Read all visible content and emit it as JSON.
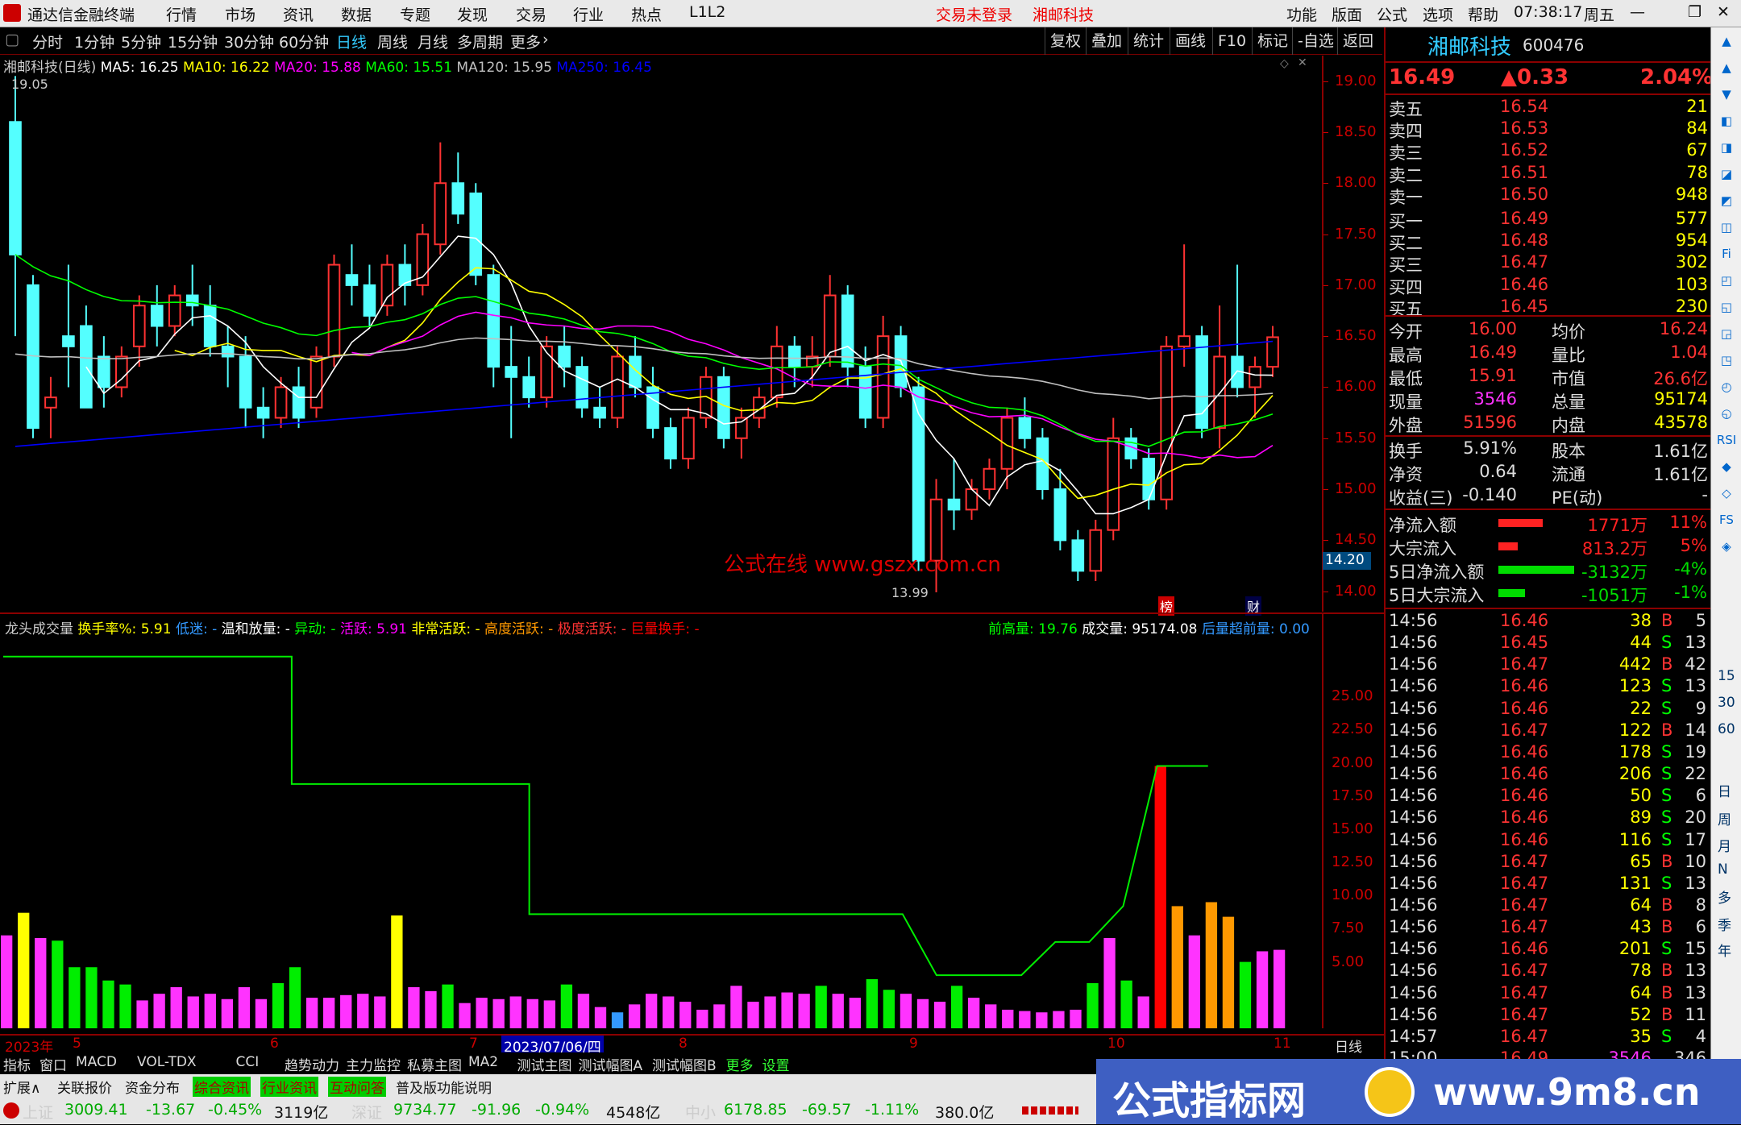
{
  "app": {
    "title": "通达信金融终端",
    "menu": [
      "行情",
      "市场",
      "资讯",
      "数据",
      "专题",
      "发现",
      "交易",
      "行业",
      "热点",
      "L1L2"
    ],
    "login_status": "交易未登录",
    "stock_link": "湘邮科技",
    "right_menu": [
      "功能",
      "版面",
      "公式",
      "选项",
      "帮助"
    ],
    "time": "07:38:17",
    "weekday": "周五"
  },
  "timeframes": [
    "分时",
    "1分钟",
    "5分钟",
    "15分钟",
    "30分钟",
    "60分钟",
    "日线",
    "周线",
    "月线",
    "多周期",
    "更多"
  ],
  "active_timeframe": "日线",
  "toolbar_right": [
    "复权",
    "叠加",
    "统计",
    "画线",
    "F10",
    "标记",
    "-自选",
    "返回"
  ],
  "main_chart": {
    "name": "湘邮科技(日线)",
    "ma": [
      {
        "label": "MA5",
        "value": "16.25",
        "color": "#ffffff"
      },
      {
        "label": "MA10",
        "value": "16.22",
        "color": "#ffff00"
      },
      {
        "label": "MA20",
        "value": "15.88",
        "color": "#ff00ff"
      },
      {
        "label": "MA60",
        "value": "15.51",
        "color": "#00ff00"
      },
      {
        "label": "MA120",
        "value": "15.95",
        "color": "#c0c0c0"
      },
      {
        "label": "MA250",
        "value": "16.45",
        "color": "#0000ff"
      }
    ],
    "high_mark": "19.05",
    "low_mark": "13.99",
    "price_ticks": [
      "19.00",
      "18.50",
      "18.00",
      "17.50",
      "17.00",
      "16.50",
      "16.00",
      "15.50",
      "15.00",
      "14.50",
      "14.00"
    ],
    "current_price_tag": "14.20",
    "watermark": "公式在线  www.gszx.com.cn",
    "event_markers": [
      "榜",
      "财"
    ]
  },
  "sub_chart": {
    "name": "龙头成交量",
    "items": [
      {
        "label": "换手率%:",
        "value": "5.91",
        "color": "#ffff00"
      },
      {
        "label": "低迷:",
        "value": "-",
        "color": "#3399ff"
      },
      {
        "label": "温和放量:",
        "value": "-",
        "color": "#ffffff"
      },
      {
        "label": "异动:",
        "value": "-",
        "color": "#00ff00"
      },
      {
        "label": "活跃:",
        "value": "5.91",
        "color": "#ff00ff"
      },
      {
        "label": "非常活跃:",
        "value": "-",
        "color": "#ffff00"
      },
      {
        "label": "高度活跃:",
        "value": "-",
        "color": "#ff9900"
      },
      {
        "label": "极度活跃:",
        "value": "-",
        "color": "#ff3333"
      },
      {
        "label": "巨量换手:",
        "value": "-",
        "color": "#ff0000"
      }
    ],
    "right_items": [
      {
        "label": "前高量:",
        "value": "19.76",
        "color": "#00ff00"
      },
      {
        "label": "成交量:",
        "value": "95174.08",
        "color": "#ffffff"
      },
      {
        "label": "后量超前量:",
        "value": "0.00",
        "color": "#3399ff"
      }
    ],
    "ticks": [
      "25.00",
      "22.50",
      "20.00",
      "17.50",
      "15.00",
      "12.50",
      "10.00",
      "7.50",
      "5.00"
    ]
  },
  "date_axis": {
    "labels": [
      "2023年",
      "5",
      "6",
      "7",
      "8",
      "9",
      "10",
      "11"
    ],
    "cursor_date": "2023/07/06/四",
    "period": "日线"
  },
  "quote": {
    "name": "湘邮科技",
    "code": "600476",
    "price": "16.49",
    "change": "▲0.33",
    "pct": "2.04%",
    "asks": [
      [
        "卖五",
        "16.54",
        "21"
      ],
      [
        "卖四",
        "16.53",
        "84"
      ],
      [
        "卖三",
        "16.52",
        "67"
      ],
      [
        "卖二",
        "16.51",
        "78"
      ],
      [
        "卖一",
        "16.50",
        "948"
      ]
    ],
    "bids": [
      [
        "买一",
        "16.49",
        "577"
      ],
      [
        "买二",
        "16.48",
        "954"
      ],
      [
        "买三",
        "16.47",
        "302"
      ],
      [
        "买四",
        "16.46",
        "103"
      ],
      [
        "买五",
        "16.45",
        "230"
      ]
    ],
    "stats": [
      [
        "今开",
        "16.00",
        "均价",
        "16.24"
      ],
      [
        "最高",
        "16.49",
        "量比",
        "1.04"
      ],
      [
        "最低",
        "15.91",
        "市值",
        "26.6亿"
      ],
      [
        "现量",
        "3546",
        "总量",
        "95174"
      ],
      [
        "外盘",
        "51596",
        "内盘",
        "43578"
      ]
    ],
    "stats2": [
      [
        "换手",
        "5.91%",
        "股本",
        "1.61亿"
      ],
      [
        "净资",
        "0.64",
        "流通",
        "1.61亿"
      ],
      [
        "收益(三)",
        "-0.140",
        "PE(动)",
        "-"
      ]
    ],
    "flows": [
      {
        "label": "净流入额",
        "value": "1771万",
        "pct": "11%",
        "bar": 0.5,
        "color": "#ff2222"
      },
      {
        "label": "大宗流入",
        "value": "813.2万",
        "pct": "5%",
        "bar": 0.22,
        "color": "#ff2222"
      },
      {
        "label": "5日净流入额",
        "value": "-3132万",
        "pct": "-4%",
        "bar": 0.85,
        "color": "#00dd00"
      },
      {
        "label": "5日大宗流入",
        "value": "-1051万",
        "pct": "-1%",
        "bar": 0.3,
        "color": "#00dd00"
      }
    ],
    "ticks": [
      [
        "14:56",
        "16.46",
        "38",
        "B",
        "5"
      ],
      [
        "14:56",
        "16.45",
        "44",
        "S",
        "13"
      ],
      [
        "14:56",
        "16.47",
        "442",
        "B",
        "42"
      ],
      [
        "14:56",
        "16.46",
        "123",
        "S",
        "13"
      ],
      [
        "14:56",
        "16.46",
        "22",
        "S",
        "9"
      ],
      [
        "14:56",
        "16.47",
        "122",
        "B",
        "14"
      ],
      [
        "14:56",
        "16.46",
        "178",
        "S",
        "19"
      ],
      [
        "14:56",
        "16.46",
        "206",
        "S",
        "22"
      ],
      [
        "14:56",
        "16.46",
        "50",
        "S",
        "6"
      ],
      [
        "14:56",
        "16.46",
        "89",
        "S",
        "20"
      ],
      [
        "14:56",
        "16.46",
        "116",
        "S",
        "17"
      ],
      [
        "14:56",
        "16.47",
        "65",
        "B",
        "10"
      ],
      [
        "14:56",
        "16.47",
        "131",
        "S",
        "13"
      ],
      [
        "14:56",
        "16.47",
        "64",
        "B",
        "8"
      ],
      [
        "14:56",
        "16.47",
        "43",
        "B",
        "6"
      ],
      [
        "14:56",
        "16.46",
        "201",
        "S",
        "15"
      ],
      [
        "14:56",
        "16.47",
        "78",
        "B",
        "13"
      ],
      [
        "14:56",
        "16.47",
        "64",
        "B",
        "13"
      ],
      [
        "14:56",
        "16.47",
        "52",
        "B",
        "11"
      ],
      [
        "14:57",
        "16.47",
        "35",
        "S",
        "4"
      ],
      [
        "15:00",
        "16.49",
        "3546",
        "",
        "346"
      ]
    ]
  },
  "side_labels": [
    "日",
    "周",
    "月",
    "N",
    "多",
    "季",
    "年",
    "15",
    "30",
    "60"
  ],
  "bottom_tabs": [
    "指标",
    "窗口",
    "MACD",
    "VOL-TDX",
    "CCI",
    "趋势动力",
    "主力监控",
    "私募主图",
    "MA2",
    "测试主图",
    "测试幅图A",
    "测试幅图B",
    "更多",
    "设置"
  ],
  "bottom_tabs2": [
    "扩展∧",
    "关联报价",
    "资金分布",
    "综合资讯",
    "行业资讯",
    "互动问答",
    "普及版功能说明"
  ],
  "status": {
    "sh_label": "上证",
    "sh": "3009.41",
    "sh_chg": "-13.67",
    "sh_pct": "-0.45%",
    "sh_amt": "3119亿",
    "sz_label": "深证",
    "sz": "9734.77",
    "sz_chg": "-91.96",
    "sz_pct": "-0.94%",
    "sz_amt": "4548亿",
    "zx_label": "中小",
    "zx": "6178.85",
    "zx_chg": "-69.57",
    "zx_pct": "-1.11%",
    "zx_amt": "380.0亿"
  },
  "banner": {
    "text": "公式指标网",
    "url": "www.9m8.cn"
  },
  "candles": [
    [
      18.6,
      19.05,
      16.5,
      17.3
    ],
    [
      17.0,
      17.1,
      15.5,
      15.6
    ],
    [
      15.8,
      16.1,
      15.5,
      15.9
    ],
    [
      16.5,
      17.2,
      16.0,
      16.4
    ],
    [
      16.6,
      16.8,
      15.8,
      15.8
    ],
    [
      16.3,
      16.5,
      15.8,
      16.0
    ],
    [
      16.0,
      16.4,
      15.9,
      16.3
    ],
    [
      16.4,
      16.9,
      16.2,
      16.8
    ],
    [
      16.8,
      17.0,
      16.4,
      16.6
    ],
    [
      16.6,
      17.0,
      16.5,
      16.9
    ],
    [
      16.9,
      17.2,
      16.6,
      16.8
    ],
    [
      16.8,
      17.0,
      16.3,
      16.4
    ],
    [
      16.4,
      16.6,
      16.0,
      16.3
    ],
    [
      16.3,
      16.5,
      15.6,
      15.8
    ],
    [
      15.8,
      16.0,
      15.5,
      15.7
    ],
    [
      15.7,
      16.1,
      15.6,
      16.0
    ],
    [
      16.0,
      16.2,
      15.6,
      15.7
    ],
    [
      15.8,
      16.4,
      15.7,
      16.3
    ],
    [
      16.3,
      17.3,
      16.2,
      17.2
    ],
    [
      17.1,
      17.4,
      16.8,
      17.0
    ],
    [
      17.0,
      17.2,
      16.6,
      16.7
    ],
    [
      16.8,
      17.3,
      16.7,
      17.2
    ],
    [
      17.2,
      17.4,
      16.8,
      17.0
    ],
    [
      17.0,
      17.6,
      16.9,
      17.5
    ],
    [
      17.4,
      18.4,
      17.3,
      18.0
    ],
    [
      18.0,
      18.3,
      17.6,
      17.7
    ],
    [
      17.9,
      18.0,
      17.0,
      17.1
    ],
    [
      17.1,
      17.2,
      16.0,
      16.2
    ],
    [
      16.2,
      16.6,
      15.5,
      16.1
    ],
    [
      16.1,
      16.3,
      15.8,
      15.9
    ],
    [
      15.9,
      16.5,
      15.8,
      16.4
    ],
    [
      16.4,
      16.6,
      16.0,
      16.2
    ],
    [
      16.2,
      16.3,
      15.7,
      15.8
    ],
    [
      15.8,
      16.0,
      15.6,
      15.7
    ],
    [
      15.7,
      16.4,
      15.6,
      16.3
    ],
    [
      16.3,
      16.5,
      15.9,
      16.0
    ],
    [
      16.0,
      16.2,
      15.5,
      15.6
    ],
    [
      15.6,
      15.7,
      15.2,
      15.3
    ],
    [
      15.3,
      15.8,
      15.2,
      15.7
    ],
    [
      15.7,
      16.2,
      15.6,
      16.1
    ],
    [
      16.1,
      16.2,
      15.4,
      15.5
    ],
    [
      15.5,
      15.8,
      15.3,
      15.7
    ],
    [
      15.7,
      16.0,
      15.6,
      15.9
    ],
    [
      15.9,
      16.6,
      15.8,
      16.4
    ],
    [
      16.4,
      16.5,
      16.0,
      16.2
    ],
    [
      16.2,
      16.5,
      16.0,
      16.3
    ],
    [
      16.3,
      17.1,
      16.2,
      16.9
    ],
    [
      16.9,
      17.0,
      16.0,
      16.2
    ],
    [
      16.2,
      16.4,
      15.6,
      15.7
    ],
    [
      15.7,
      16.7,
      15.6,
      16.5
    ],
    [
      16.5,
      16.6,
      15.9,
      16.0
    ],
    [
      16.0,
      16.1,
      14.2,
      14.3
    ],
    [
      14.3,
      15.1,
      13.99,
      14.9
    ],
    [
      14.9,
      15.3,
      14.6,
      14.8
    ],
    [
      14.8,
      15.1,
      14.7,
      15.0
    ],
    [
      15.0,
      15.3,
      14.9,
      15.2
    ],
    [
      15.2,
      15.8,
      15.0,
      15.7
    ],
    [
      15.7,
      15.9,
      15.4,
      15.5
    ],
    [
      15.5,
      15.6,
      14.9,
      15.0
    ],
    [
      15.0,
      15.2,
      14.4,
      14.5
    ],
    [
      14.5,
      14.6,
      14.1,
      14.2
    ],
    [
      14.2,
      14.7,
      14.1,
      14.6
    ],
    [
      14.6,
      15.7,
      14.5,
      15.5
    ],
    [
      15.5,
      15.6,
      15.2,
      15.3
    ],
    [
      15.3,
      15.4,
      14.8,
      14.9
    ],
    [
      14.9,
      16.5,
      14.8,
      16.4
    ],
    [
      16.4,
      17.4,
      16.2,
      16.5
    ],
    [
      16.5,
      16.6,
      15.5,
      15.6
    ],
    [
      15.6,
      16.8,
      15.4,
      16.3
    ],
    [
      16.3,
      17.2,
      15.9,
      16.0
    ],
    [
      16.0,
      16.3,
      15.7,
      16.2
    ],
    [
      16.2,
      16.6,
      16.1,
      16.49
    ]
  ],
  "volumes": [
    [
      7,
      "#ff33ff"
    ],
    [
      8.7,
      "#ffff00"
    ],
    [
      6.8,
      "#ff33ff"
    ],
    [
      6.6,
      "#00ee00"
    ],
    [
      4.6,
      "#00ee00"
    ],
    [
      4.6,
      "#00ee00"
    ],
    [
      3.6,
      "#00ee00"
    ],
    [
      3.3,
      "#00ee00"
    ],
    [
      2.1,
      "#ff33ff"
    ],
    [
      2.6,
      "#ff33ff"
    ],
    [
      3.1,
      "#ff33ff"
    ],
    [
      2.4,
      "#ff33ff"
    ],
    [
      2.6,
      "#ff33ff"
    ],
    [
      2.2,
      "#ff33ff"
    ],
    [
      3.1,
      "#ff33ff"
    ],
    [
      2.2,
      "#ff33ff"
    ],
    [
      3.4,
      "#00ee00"
    ],
    [
      4.6,
      "#00ee00"
    ],
    [
      2.3,
      "#ff33ff"
    ],
    [
      2.3,
      "#ff33ff"
    ],
    [
      2.5,
      "#ff33ff"
    ],
    [
      2.6,
      "#ff33ff"
    ],
    [
      2.4,
      "#ff33ff"
    ],
    [
      8.5,
      "#ffff00"
    ],
    [
      3.1,
      "#ff33ff"
    ],
    [
      2.8,
      "#ff33ff"
    ],
    [
      3.3,
      "#00ee00"
    ],
    [
      1.9,
      "#ff33ff"
    ],
    [
      2.3,
      "#ff33ff"
    ],
    [
      2.2,
      "#ff33ff"
    ],
    [
      2.4,
      "#ff33ff"
    ],
    [
      2.2,
      "#ff33ff"
    ],
    [
      2.1,
      "#ff33ff"
    ],
    [
      3.3,
      "#00ee00"
    ],
    [
      2.6,
      "#ff33ff"
    ],
    [
      1.6,
      "#ff33ff"
    ],
    [
      1.2,
      "#3399ff"
    ],
    [
      1.8,
      "#ff33ff"
    ],
    [
      2.6,
      "#ff33ff"
    ],
    [
      2.4,
      "#ff33ff"
    ],
    [
      2.0,
      "#ff33ff"
    ],
    [
      1.4,
      "#ff33ff"
    ],
    [
      1.8,
      "#ff33ff"
    ],
    [
      3.2,
      "#ff33ff"
    ],
    [
      2.0,
      "#ff33ff"
    ],
    [
      2.4,
      "#ff33ff"
    ],
    [
      2.7,
      "#ff33ff"
    ],
    [
      2.6,
      "#ff33ff"
    ],
    [
      3.2,
      "#00ee00"
    ],
    [
      2.6,
      "#ff33ff"
    ],
    [
      2.3,
      "#ff33ff"
    ],
    [
      3.7,
      "#00ee00"
    ],
    [
      2.9,
      "#00ee00"
    ],
    [
      2.6,
      "#ff33ff"
    ],
    [
      2.2,
      "#ff33ff"
    ],
    [
      2.0,
      "#ff33ff"
    ],
    [
      3.2,
      "#00ee00"
    ],
    [
      2.3,
      "#ff33ff"
    ],
    [
      1.8,
      "#ff33ff"
    ],
    [
      1.4,
      "#ff33ff"
    ],
    [
      1.3,
      "#ff33ff"
    ],
    [
      1.2,
      "#ff33ff"
    ],
    [
      1.3,
      "#ff33ff"
    ],
    [
      1.4,
      "#ff33ff"
    ],
    [
      3.4,
      "#00ee00"
    ],
    [
      6.8,
      "#ff33ff"
    ],
    [
      3.6,
      "#00ee00"
    ],
    [
      2.4,
      "#ff33ff"
    ],
    [
      19.76,
      "#ff0000"
    ],
    [
      9.2,
      "#ff9900"
    ],
    [
      7.0,
      "#ff33ff"
    ],
    [
      9.5,
      "#ff9900"
    ],
    [
      8.4,
      "#ff9900"
    ],
    [
      5.0,
      "#00ee00"
    ],
    [
      5.8,
      "#ff33ff"
    ],
    [
      5.91,
      "#ff33ff"
    ]
  ],
  "prev_high_line": [
    [
      0,
      28
    ],
    [
      17,
      28
    ],
    [
      17,
      18.4
    ],
    [
      31,
      18.4
    ],
    [
      31,
      8.6
    ],
    [
      33,
      8.6
    ],
    [
      53,
      8.6
    ],
    [
      55,
      4.0
    ],
    [
      60,
      4.0
    ],
    [
      62,
      6.5
    ],
    [
      64,
      6.5
    ],
    [
      66,
      9.2
    ],
    [
      68,
      19.76
    ],
    [
      71,
      19.76
    ]
  ]
}
